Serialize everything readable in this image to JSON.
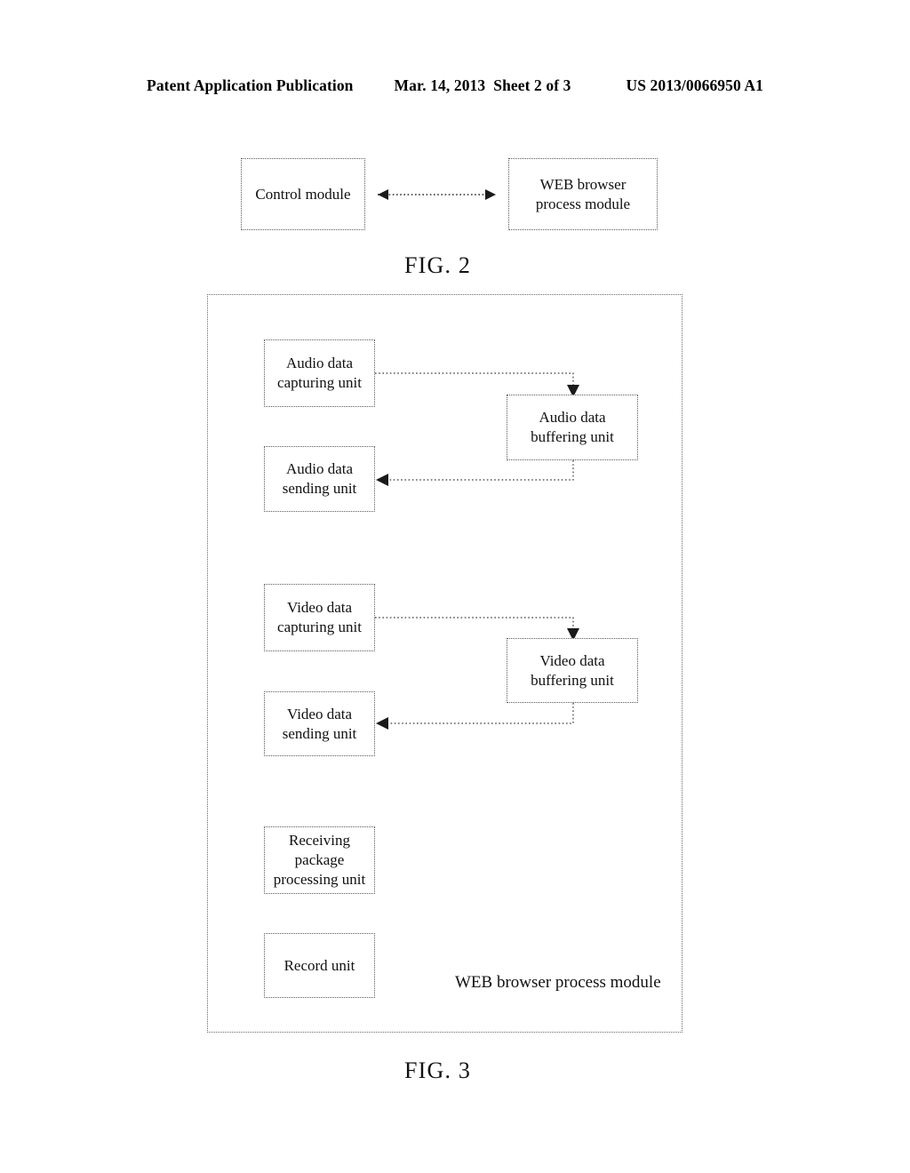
{
  "header": {
    "publication": "Patent Application Publication",
    "date": "Mar. 14, 2013",
    "sheet": "Sheet 2 of 3",
    "patent_number": "US 2013/0066950 A1"
  },
  "figures": [
    {
      "caption": "FIG. 2",
      "boxes": [
        {
          "name": "control-module",
          "label": "Control module"
        },
        {
          "name": "web-browser-process-module",
          "label": "WEB browser\nprocess module"
        }
      ],
      "connectors": [
        {
          "from": "control-module",
          "to": "web-browser-process-module",
          "style": "dotted",
          "arrows": "both"
        }
      ]
    },
    {
      "caption": "FIG. 3",
      "container_label": "WEB browser process module",
      "boxes": [
        {
          "name": "audio-data-capturing-unit",
          "line1": "Audio data",
          "line2": "capturing unit"
        },
        {
          "name": "audio-data-buffering-unit",
          "line1": "Audio data",
          "line2": "buffering unit"
        },
        {
          "name": "audio-data-sending-unit",
          "line1": "Audio data",
          "line2": "sending unit"
        },
        {
          "name": "video-data-capturing-unit",
          "line1": "Video data",
          "line2": "capturing unit"
        },
        {
          "name": "video-data-buffering-unit",
          "line1": "Video data",
          "line2": "buffering unit"
        },
        {
          "name": "video-data-sending-unit",
          "line1": "Video data",
          "line2": "sending unit"
        },
        {
          "name": "receiving-package-processing-unit",
          "line1": "Receiving",
          "line2": "package",
          "line3": "processing unit"
        },
        {
          "name": "record-unit",
          "line1": "Record unit",
          "line2": "",
          "line3": ""
        }
      ],
      "connectors": [
        {
          "from": "audio-data-capturing-unit",
          "to": "audio-data-buffering-unit",
          "style": "dotted",
          "arrows": "end"
        },
        {
          "from": "audio-data-buffering-unit",
          "to": "audio-data-sending-unit",
          "style": "dotted",
          "arrows": "end"
        },
        {
          "from": "video-data-capturing-unit",
          "to": "video-data-buffering-unit",
          "style": "dotted",
          "arrows": "end"
        },
        {
          "from": "video-data-buffering-unit",
          "to": "video-data-sending-unit",
          "style": "dotted",
          "arrows": "end"
        }
      ]
    }
  ],
  "fig2": {
    "caption": "FIG. 2",
    "control_module": "Control module",
    "web_browser_module_line1": "WEB browser",
    "web_browser_module_line2": "process module"
  },
  "fig3": {
    "caption": "FIG. 3",
    "container_label": "WEB browser process module",
    "audio_capturing_line1": "Audio data",
    "audio_capturing_line2": "capturing unit",
    "audio_buffering_line1": "Audio data",
    "audio_buffering_line2": "buffering unit",
    "audio_sending_line1": "Audio data",
    "audio_sending_line2": "sending unit",
    "video_capturing_line1": "Video data",
    "video_capturing_line2": "capturing unit",
    "video_buffering_line1": "Video data",
    "video_buffering_line2": "buffering unit",
    "video_sending_line1": "Video data",
    "video_sending_line2": "sending unit",
    "receiving_line1": "Receiving",
    "receiving_line2": "package",
    "receiving_line3": "processing unit",
    "record_unit": "Record unit"
  },
  "colors": {
    "ink": "#111111",
    "border": "#5a5a5a",
    "background": "#ffffff"
  }
}
